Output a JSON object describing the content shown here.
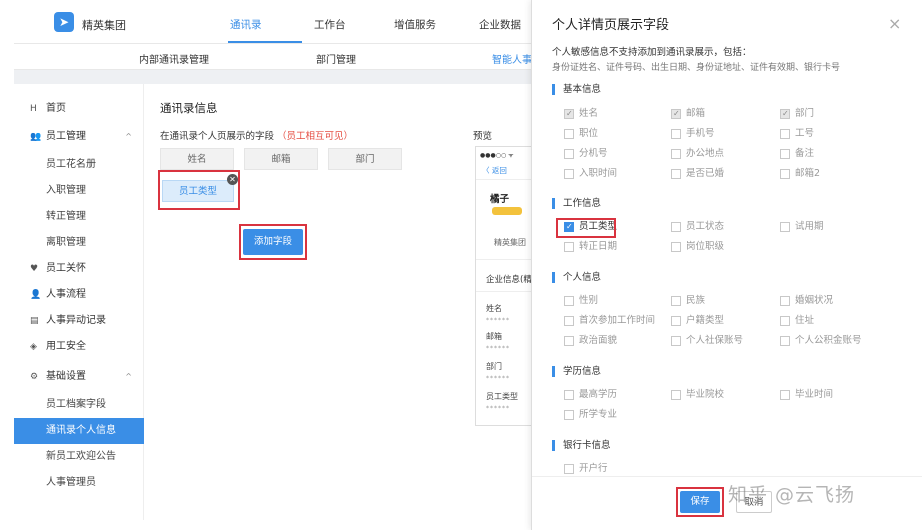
{
  "header": {
    "brand": "精英集团",
    "nav": [
      "通讯录",
      "工作台",
      "增值服务",
      "企业数据"
    ]
  },
  "subnav": [
    "内部通讯录管理",
    "部门管理",
    "智能人事"
  ],
  "sidebar": {
    "items": [
      {
        "label": "首页",
        "icon": "H"
      },
      {
        "label": "员工管理",
        "icon": "👥",
        "caret": "^"
      },
      {
        "label": "员工花名册"
      },
      {
        "label": "入职管理"
      },
      {
        "label": "转正管理"
      },
      {
        "label": "离职管理"
      },
      {
        "label": "员工关怀",
        "icon": "♥"
      },
      {
        "label": "人事流程",
        "icon": "👤"
      },
      {
        "label": "人事异动记录",
        "icon": "▤"
      },
      {
        "label": "用工安全",
        "icon": "◈"
      },
      {
        "label": "基础设置",
        "icon": "⚙",
        "caret": "^"
      },
      {
        "label": "员工档案字段"
      },
      {
        "label": "通讯录个人信息"
      },
      {
        "label": "新员工欢迎公告"
      },
      {
        "label": "人事管理员"
      }
    ]
  },
  "main": {
    "title": "通讯录信息",
    "hint": "在通讯录个人页展示的字段",
    "hint_note": "（员工相互可见）",
    "fields": [
      "姓名",
      "邮箱",
      "部门"
    ],
    "picked_field": "员工类型",
    "add_button": "添加字段",
    "preview_label": "预览"
  },
  "preview": {
    "status": "●●●○○ ᯤ",
    "back": "〈 返回",
    "name": "橘子",
    "org": "精英集团",
    "section": "企业信息(精",
    "rows": [
      {
        "label": "姓名",
        "value": "******"
      },
      {
        "label": "邮箱",
        "value": "******"
      },
      {
        "label": "部门",
        "value": "******"
      },
      {
        "label": "员工类型",
        "value": "******"
      }
    ]
  },
  "panel": {
    "title": "个人详情页展示字段",
    "close": "×",
    "note1": "个人敏感信息不支持添加到通讯录展示，包括：",
    "note2": "身份证姓名、证件号码、出生日期、身份证地址、证件有效期、银行卡号",
    "sections": {
      "basic": {
        "title": "基本信息",
        "fields": [
          {
            "label": "姓名",
            "checked": true
          },
          {
            "label": "邮箱",
            "checked": true
          },
          {
            "label": "部门",
            "checked": true
          },
          {
            "label": "职位"
          },
          {
            "label": "手机号"
          },
          {
            "label": "工号"
          },
          {
            "label": "分机号"
          },
          {
            "label": "办公地点"
          },
          {
            "label": "备注"
          },
          {
            "label": "入职时间"
          },
          {
            "label": "是否已婚"
          },
          {
            "label": "邮箱2"
          }
        ]
      },
      "work": {
        "title": "工作信息",
        "fields": [
          {
            "label": "员工类型",
            "checked": true
          },
          {
            "label": "员工状态"
          },
          {
            "label": "试用期"
          },
          {
            "label": "转正日期"
          },
          {
            "label": "岗位职级"
          }
        ]
      },
      "personal": {
        "title": "个人信息",
        "fields": [
          {
            "label": "性别"
          },
          {
            "label": "民族"
          },
          {
            "label": "婚姻状况"
          },
          {
            "label": "首次参加工作时间"
          },
          {
            "label": "户籍类型"
          },
          {
            "label": "住址"
          },
          {
            "label": "政治面貌"
          },
          {
            "label": "个人社保账号"
          },
          {
            "label": "个人公积金账号"
          }
        ]
      },
      "education": {
        "title": "学历信息",
        "fields": [
          {
            "label": "最高学历"
          },
          {
            "label": "毕业院校"
          },
          {
            "label": "毕业时间"
          },
          {
            "label": "所学专业"
          }
        ]
      },
      "bank": {
        "title": "银行卡信息",
        "fields": [
          {
            "label": "开户行"
          }
        ]
      }
    },
    "save": "保存",
    "cancel": "取消",
    "watermark": "知乎 @云飞扬"
  },
  "colors": {
    "accent": "#3a8ee6",
    "highlight": "#d9333f",
    "note_red": "#e54d42"
  }
}
